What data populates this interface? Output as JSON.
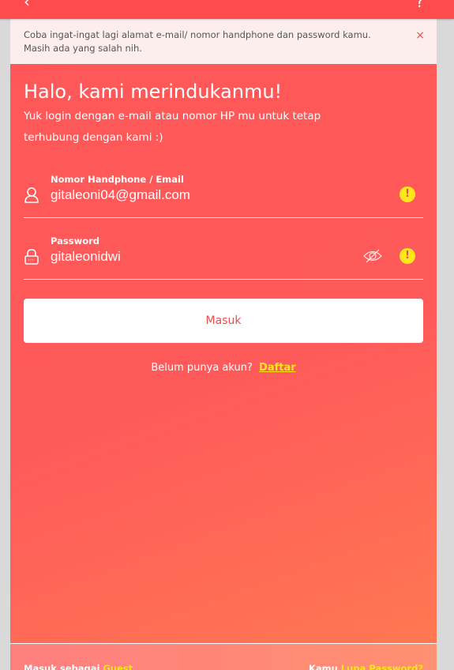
{
  "alert": {
    "message": "Coba ingat-ingat lagi alamat e-mail/ nomor handphone dan password kamu. Masih ada yang salah nih.",
    "close": "×"
  },
  "heading": {
    "title": "Halo, kami merindukanmu!",
    "subtitle": "Yuk login dengan e-mail atau nomor HP mu untuk tetap terhubung dengan kami :)"
  },
  "form": {
    "identity": {
      "label": "Nomor Handphone / Email",
      "value": "gitaleoni04@gmail.com",
      "icon": "user-icon",
      "status": "warning"
    },
    "password": {
      "label": "Password",
      "value": "gitaleonidwi",
      "icon": "lock-icon",
      "status": "warning"
    },
    "warn_glyph": "!",
    "submit": "Masuk"
  },
  "register": {
    "prompt": "Belum punya akun?",
    "link": "Daftar"
  },
  "footer": {
    "guest_prefix": "Masuk sebagai",
    "guest_link": "Guest",
    "forgot_prefix": "Kamu",
    "forgot_link": "Lupa Password?"
  },
  "colors": {
    "primary": "#ff4b4b",
    "accent": "#ffe81a"
  }
}
